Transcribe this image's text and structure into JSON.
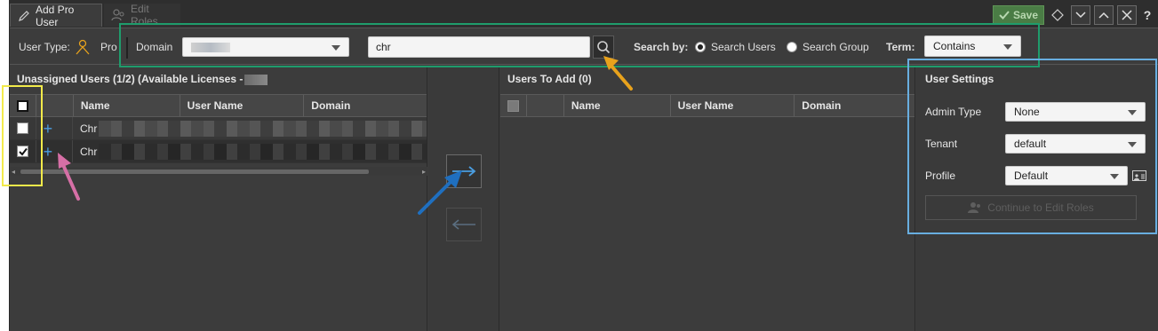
{
  "tabs": [
    {
      "label": "Add Pro User",
      "active": true
    },
    {
      "label": "Edit Roles",
      "active": false
    }
  ],
  "toolbar": {
    "save_label": "Save",
    "help_label": "?"
  },
  "filter": {
    "user_type_label": "User Type:",
    "user_type_value": "Pro",
    "domain_label": "Domain",
    "search_value": "chr",
    "search_by_label": "Search by:",
    "radio_users": "Search Users",
    "radio_group": "Search Group",
    "term_label": "Term:",
    "term_value": "Contains"
  },
  "unassigned": {
    "title": "Unassigned Users (1/2) (Available Licenses -",
    "columns": [
      "Name",
      "User Name",
      "Domain"
    ],
    "rows": [
      {
        "name": "Chr",
        "checked": false
      },
      {
        "name": "Chr",
        "checked": true
      }
    ]
  },
  "to_add": {
    "title": "Users To Add (0)",
    "columns": [
      "Name",
      "User Name",
      "Domain"
    ]
  },
  "settings": {
    "title": "User Settings",
    "admin_type_label": "Admin Type",
    "admin_type_value": "None",
    "tenant_label": "Tenant",
    "tenant_value": "default",
    "profile_label": "Profile",
    "profile_value": "Default",
    "continue_label": "Continue to Edit Roles"
  },
  "colors": {
    "background": "#3c3c3c",
    "accent_blue": "#4a9de0",
    "highlight_green": "#1f9c6c",
    "highlight_yellow": "#f2ea4a",
    "highlight_blue": "#68aee0",
    "arrow_orange": "#e8a21c",
    "arrow_pink": "#d66fa6",
    "arrow_blue": "#1f6fbf"
  }
}
